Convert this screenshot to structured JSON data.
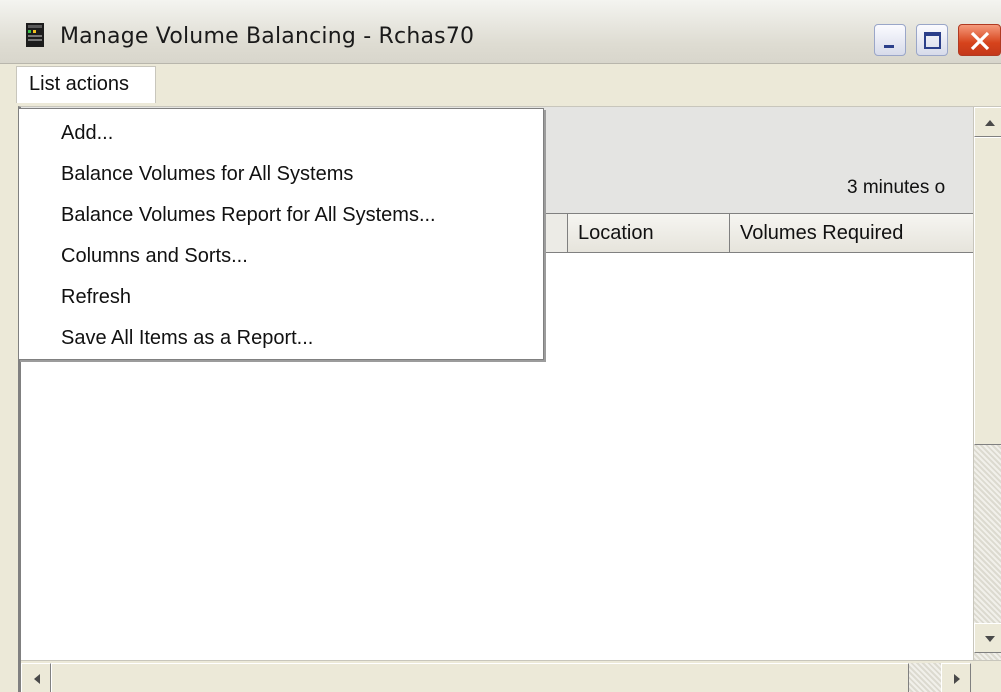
{
  "window": {
    "title": "Manage Volume Balancing - Rchas70"
  },
  "menubar": {
    "list_actions": "List actions"
  },
  "dropdown": {
    "items": [
      "Add...",
      "Balance Volumes for All Systems",
      "Balance Volumes Report for All Systems...",
      "Columns and Sorts...",
      "Refresh",
      "Save All Items as a Report..."
    ]
  },
  "content": {
    "refresh_info": "3 minutes o",
    "columns": [
      "Location",
      "Volumes Required"
    ]
  },
  "icons": {
    "app": "system-server-icon",
    "minimize": "minimize-icon",
    "maximize": "maximize-icon",
    "close": "close-icon",
    "scroll_up": "arrow-up-icon",
    "scroll_down": "arrow-down-icon",
    "scroll_left": "arrow-left-icon",
    "scroll_right": "arrow-right-icon"
  },
  "colors": {
    "window_bg": "#ece9d8",
    "close_button": "#d6431b",
    "panel_bg": "#e4e4e2"
  }
}
